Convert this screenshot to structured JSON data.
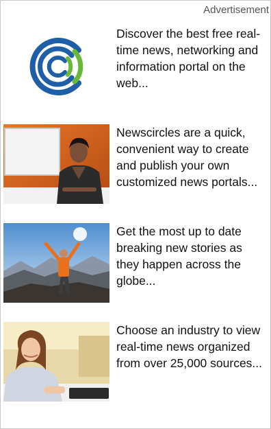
{
  "ad_label": "Advertisement",
  "ads": [
    {
      "image": "circles-logo-icon",
      "lines": [
        "Discover the best free real-",
        "time news, networking and",
        "information portal on the",
        "web..."
      ]
    },
    {
      "image": "news-anchor-photo",
      "lines": [
        "Newscircles are a quick,",
        "convenient way to create",
        "and publish your own",
        "customized news portals..."
      ]
    },
    {
      "image": "mountain-climber-photo",
      "lines": [
        "Get the most up to date",
        "breaking new stories as",
        "they happen across the",
        "globe..."
      ]
    },
    {
      "image": "office-woman-photo",
      "lines": [
        "Choose an industry to view",
        "real-time news organized",
        "from over 25,000 sources..."
      ]
    }
  ],
  "colors": {
    "logo_blue": "#1f5fa8",
    "logo_green": "#6ab83a",
    "border": "#c8c8c8"
  }
}
